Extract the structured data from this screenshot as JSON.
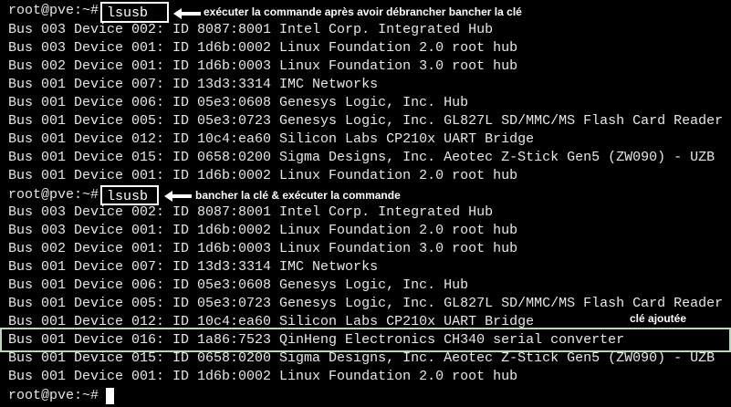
{
  "terminal": {
    "prompt": "root@pve:~#",
    "command_1": "lsusb",
    "annotation_1": "exécuter la commande après avoir débrancher bancher la clé",
    "output_1": [
      "Bus 003 Device 002: ID 8087:8001 Intel Corp. Integrated Hub",
      "Bus 003 Device 001: ID 1d6b:0002 Linux Foundation 2.0 root hub",
      "Bus 002 Device 001: ID 1d6b:0003 Linux Foundation 3.0 root hub",
      "Bus 001 Device 007: ID 13d3:3314 IMC Networks",
      "Bus 001 Device 006: ID 05e3:0608 Genesys Logic, Inc. Hub",
      "Bus 001 Device 005: ID 05e3:0723 Genesys Logic, Inc. GL827L SD/MMC/MS Flash Card Reader",
      "Bus 001 Device 012: ID 10c4:ea60 Silicon Labs CP210x UART Bridge",
      "Bus 001 Device 015: ID 0658:0200 Sigma Designs, Inc. Aeotec Z-Stick Gen5 (ZW090) - UZB",
      "Bus 001 Device 001: ID 1d6b:0002 Linux Foundation 2.0 root hub"
    ],
    "command_2": "lsusb",
    "annotation_2": "bancher la clé & exécuter la commande",
    "output_2": [
      "Bus 003 Device 002: ID 8087:8001 Intel Corp. Integrated Hub",
      "Bus 003 Device 001: ID 1d6b:0002 Linux Foundation 2.0 root hub",
      "Bus 002 Device 001: ID 1d6b:0003 Linux Foundation 3.0 root hub",
      "Bus 001 Device 007: ID 13d3:3314 IMC Networks",
      "Bus 001 Device 006: ID 05e3:0608 Genesys Logic, Inc. Hub",
      "Bus 001 Device 005: ID 05e3:0723 Genesys Logic, Inc. GL827L SD/MMC/MS Flash Card Reader",
      "Bus 001 Device 012: ID 10c4:ea60 Silicon Labs CP210x UART Bridge",
      "Bus 001 Device 016: ID 1a86:7523 QinHeng Electronics CH340 serial converter",
      "Bus 001 Device 015: ID 0658:0200 Sigma Designs, Inc. Aeotec Z-Stick Gen5 (ZW090) - UZB",
      "Bus 001 Device 001: ID 1d6b:0002 Linux Foundation 2.0 root hub"
    ],
    "added_label": "clé ajoutée",
    "colors": {
      "background": "#000000",
      "text": "#e6e6e6",
      "highlight_border": "#b8dab8"
    },
    "icons": [
      "left-arrow-icon",
      "left-arrow-icon",
      "cursor-block"
    ]
  }
}
